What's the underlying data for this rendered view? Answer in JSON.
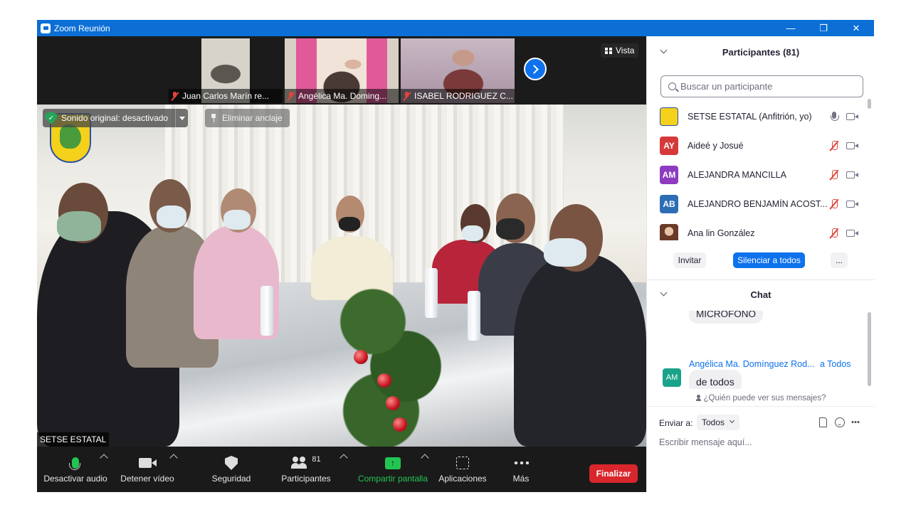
{
  "window": {
    "title": "Zoom Reunión",
    "controls": {
      "minimize": "—",
      "restore": "❐",
      "close": "✕"
    }
  },
  "colors": {
    "title_bar": "#0b6fd6",
    "accent": "#0e72ed",
    "end_button": "#d9262c",
    "mic_on": "#23c552",
    "muted": "#e0453a"
  },
  "strip": {
    "thumbnails": [
      {
        "name": "Juan Carlos Marín re...",
        "muted": true
      },
      {
        "name": "Angélica Ma. Doming...",
        "muted": true
      },
      {
        "name": "ISABEL RODRIGUEZ C...",
        "muted": true
      }
    ],
    "view_label": "Vista",
    "next_icon": "chevron-right-icon"
  },
  "main": {
    "sound_badge": "Sonido original: desactivado",
    "unpin_label": "Eliminar anclaje",
    "speaker_name": "SETSE ESTATAL"
  },
  "toolbar": {
    "audio": "Desactivar audio",
    "video": "Detener vídeo",
    "security": "Seguridad",
    "participants": "Participantes",
    "participants_count": "81",
    "share": "Compartir pantalla",
    "apps": "Aplicaciones",
    "more": "Más",
    "end": "Finalizar"
  },
  "participants_panel": {
    "title": "Participantes (81)",
    "search_placeholder": "Buscar un participante",
    "list": [
      {
        "initials": "",
        "name": "SETSE ESTATAL (Anfitrión, yo)",
        "color": "#f4d11a",
        "mic": "on"
      },
      {
        "initials": "AY",
        "name": "Aideé y Josué",
        "color": "#d6393a",
        "mic": "off"
      },
      {
        "initials": "AM",
        "name": "ALEJANDRA MANCILLA",
        "color": "#8e3bbf",
        "mic": "off"
      },
      {
        "initials": "AB",
        "name": "ALEJANDRO BENJAMÍN ACOST...",
        "color": "#2d6db5",
        "mic": "off"
      },
      {
        "initials": "",
        "name": "Ana lin González",
        "color": "#c98a6b",
        "mic": "off"
      }
    ],
    "invite": "Invitar",
    "mute_all": "Silenciar a todos",
    "more": "..."
  },
  "chat": {
    "title": "Chat",
    "prev_message": "MICRÓFONO",
    "sender": "Angélica Ma. Domínguez Rod...",
    "recipient": "a Todos",
    "sender_initials": "AM",
    "message": "de todos",
    "who_sees": "¿Quién puede ver sus mensajes?",
    "send_to_label": "Enviar a:",
    "send_to_value": "Todos",
    "input_placeholder": "Escribir mensaje aquí...",
    "more_icon": "···"
  }
}
